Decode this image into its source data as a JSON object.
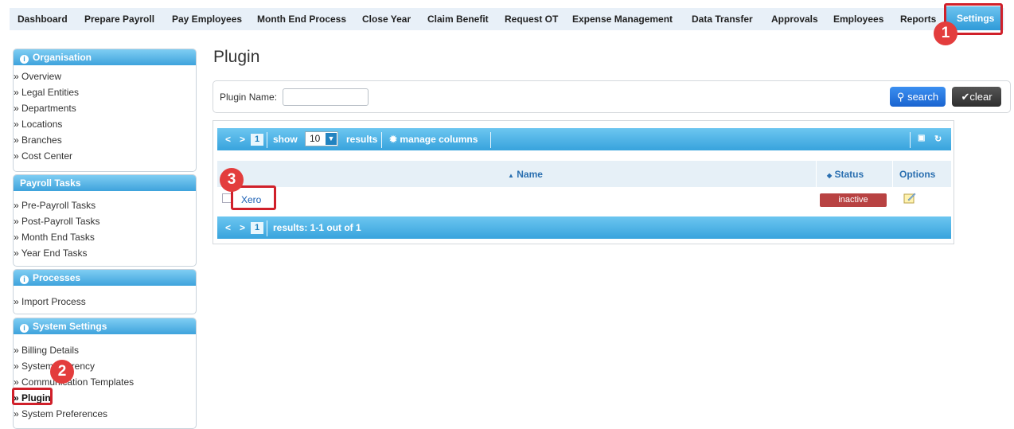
{
  "nav": {
    "items": [
      "Dashboard",
      "Prepare Payroll",
      "Pay Employees",
      "Month End Process",
      "Close Year",
      "Claim Benefit",
      "Request OT",
      "Expense Management",
      "Data Transfer",
      "Approvals",
      "Employees",
      "Reports"
    ],
    "settings": "Settings"
  },
  "sidebar": {
    "organisation": {
      "title": "Organisation",
      "links": [
        "» Overview",
        "» Legal Entities",
        "» Departments",
        "» Locations",
        "» Branches",
        "» Cost Center"
      ]
    },
    "payroll_tasks": {
      "title": "Payroll Tasks",
      "links": [
        "» Pre-Payroll Tasks",
        "» Post-Payroll Tasks",
        "» Month End Tasks",
        "» Year End Tasks"
      ]
    },
    "processes": {
      "title": "Processes",
      "links": [
        "» Import Process"
      ]
    },
    "system_settings": {
      "title": "System Settings",
      "links": [
        "» Billing Details",
        "» System Currency",
        "» Communication Templates",
        "» Plugin",
        "» System Preferences"
      ]
    }
  },
  "page": {
    "title": "Plugin"
  },
  "search": {
    "label": "Plugin Name:",
    "value": "",
    "search_label": "search",
    "clear_label": "clear"
  },
  "grid": {
    "page": "1",
    "show_label": "show",
    "page_size": "10",
    "results_label": "results",
    "manage_columns": "manage columns",
    "columns": {
      "name": "Name",
      "status": "Status",
      "options": "Options"
    },
    "rows": [
      {
        "name": "Xero",
        "status": "inactive"
      }
    ],
    "footer_results": "results: 1-1 out of 1"
  },
  "annotations": {
    "step1": "1",
    "step2": "2",
    "step3": "3"
  },
  "colors": {
    "accent": "#3ea3dc",
    "highlight": "#d0202a",
    "inactive": "#b84242"
  }
}
